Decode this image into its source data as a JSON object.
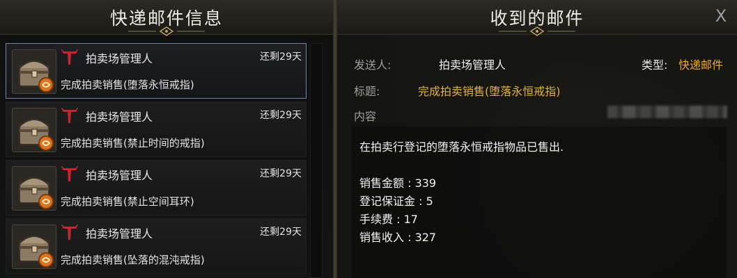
{
  "left_panel": {
    "title": "快递邮件信息",
    "mails": [
      {
        "sender": "拍卖场管理人",
        "days_left": "还剩29天",
        "subject": "完成拍卖销售(堕落永恒戒指)",
        "selected": true
      },
      {
        "sender": "拍卖场管理人",
        "days_left": "还剩29天",
        "subject": "完成拍卖销售(禁止时间的戒指)",
        "selected": false
      },
      {
        "sender": "拍卖场管理人",
        "days_left": "还剩29天",
        "subject": "完成拍卖销售(禁止空间耳环)",
        "selected": false
      },
      {
        "sender": "拍卖场管理人",
        "days_left": "还剩29天",
        "subject": "完成拍卖销售(坠落的混沌戒指)",
        "selected": false
      }
    ],
    "icons": {
      "thumbnail": "treasure-chest-icon",
      "emblem": "auction-house-emblem-icon"
    }
  },
  "right_panel": {
    "title": "收到的邮件",
    "close_glyph": "X",
    "sender_label": "发送人:",
    "sender_value": "拍卖场管理人",
    "type_label": "类型:",
    "type_value": "快递邮件",
    "subject_label": "标题:",
    "subject_value": "完成拍卖销售(堕落永恒戒指)",
    "content_label": "内容",
    "content_lines": [
      "在拍卖行登记的堕落永恒戒指物品已售出.",
      "销售金额 : 339",
      "登记保证金 : 5",
      "手续费 : 17",
      "销售收入 : 327"
    ]
  },
  "colors": {
    "accent_gold": "#e2b43a",
    "type_orange": "#f0a930",
    "selected_border": "#6d85a8",
    "emblem_red": "#c0282a"
  }
}
